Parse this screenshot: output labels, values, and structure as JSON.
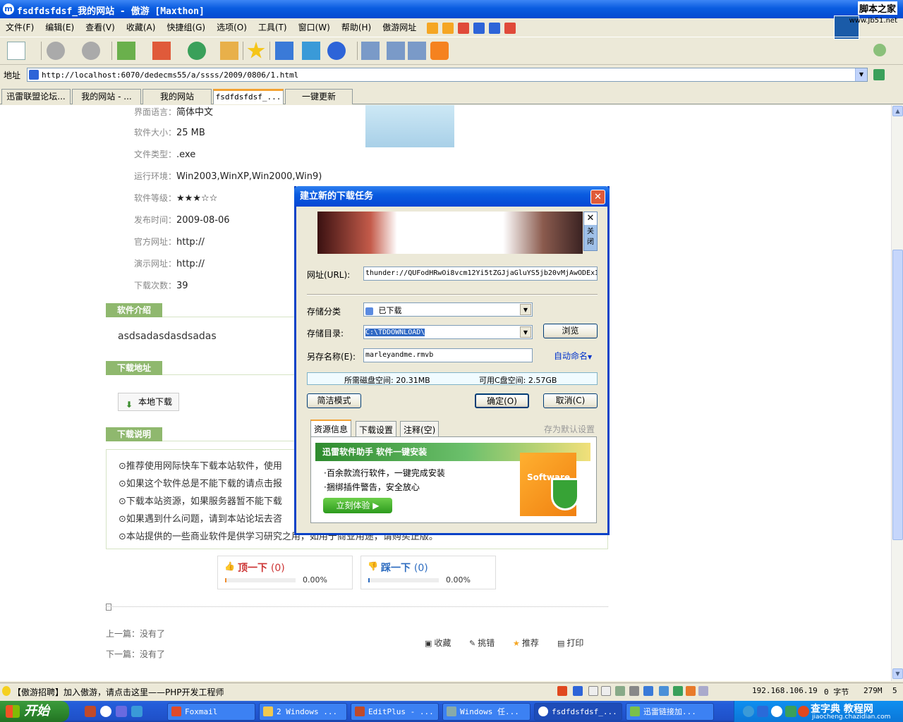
{
  "window": {
    "title": "fsdfdsfdsf_我的网站 - 傲游 [Maxthon]",
    "app_icon": "m",
    "brand_line1": "脚本之家",
    "brand_line2": "www.Jb51.net"
  },
  "menu": {
    "items": [
      "文件(F)",
      "编辑(E)",
      "查看(V)",
      "收藏(A)",
      "快捷组(G)",
      "选项(O)",
      "工具(T)",
      "窗口(W)",
      "帮助(H)",
      "傲游网址"
    ]
  },
  "address": {
    "label": "地址",
    "url": "http://localhost:6070/dedecms55/a/ssss/2009/0806/1.html"
  },
  "tabs": [
    "迅雷联盟论坛...",
    "我的网站 - ...",
    "我的网站",
    "fsdfdsfdsf_...",
    "一键更新"
  ],
  "page": {
    "info": [
      {
        "k": "界面语言：",
        "v": "简体中文"
      },
      {
        "k": "软件大小：",
        "v": "25 MB"
      },
      {
        "k": "文件类型：",
        "v": ".exe"
      },
      {
        "k": "运行环境：",
        "v": "Win2003,WinXP,Win2000,Win9)"
      },
      {
        "k": "软件等级：",
        "v": "★★★☆☆"
      },
      {
        "k": "发布时间：",
        "v": "2009-08-06"
      },
      {
        "k": "官方网址：",
        "v": "http://"
      },
      {
        "k": "演示网址：",
        "v": "http://"
      },
      {
        "k": "下载次数：",
        "v": "39"
      }
    ],
    "sec_intro": "软件介绍",
    "intro_text": "asdsadasdasdsadas",
    "sec_download": "下载地址",
    "local_download": "本地下载",
    "sec_notes": "下载说明",
    "notes": [
      "⊙推荐使用网际快车下载本站软件，使用",
      "⊙如果这个软件总是不能下载的请点击报",
      "⊙下载本站资源，如果服务器暂不能下载",
      "⊙如果遇到什么问题，请到本站论坛去咨",
      "⊙本站提供的一些商业软件是供学习研究之用，如用于商业用途，请购买正版。"
    ],
    "vote_up": {
      "label": "顶一下",
      "count": "(0)",
      "pct": "0.00%"
    },
    "vote_down": {
      "label": "踩一下",
      "count": "(0)",
      "pct": "0.00%"
    },
    "prev": "上一篇：没有了",
    "next": "下一篇：没有了",
    "actions": [
      "收藏",
      "挑错",
      "推荐",
      "打印"
    ]
  },
  "dialog": {
    "title": "建立新的下载任务",
    "banner_close_side": "关闭",
    "url_label": "网址(URL):",
    "url_value": "thunder://QUFodHRwOi8vcm12Yi5tZGJjaGluYS5jb20vMjAwODExI",
    "category_label": "存储分类",
    "category_value": "已下载",
    "dir_label": "存储目录:",
    "dir_value": "C:\\TDDOWNLOAD\\",
    "browse": "浏览",
    "saveas_label": "另存名称(E):",
    "saveas_value": "marleyandme.rmvb",
    "auto_rename": "自动命名",
    "disk_needed": "所需磁盘空间: 20.31MB",
    "disk_free": "可用C盘空间: 2.57GB",
    "simple_mode": "简洁模式",
    "ok": "确定(O)",
    "cancel": "取消(C)",
    "tabs": [
      "资源信息",
      "下载设置",
      "注释(空)"
    ],
    "save_default": "存为默认设置",
    "ad_title": "迅雷软件助手  软件一键安装",
    "ad_line1": "·百余款流行软件，一键完成安装",
    "ad_line2": "·捆绑插件警告，安全放心",
    "ad_try": "立刻体验 ▶",
    "ad_box": "Software"
  },
  "status": {
    "message": "【傲游招聘】加入傲游，请点击这里——PHP开发工程师",
    "ip": "192.168.106.19",
    "bytes": "0 字节",
    "mem": "279M",
    "num": "5"
  },
  "taskbar": {
    "start": "开始",
    "tasks": [
      "Foxmail",
      "2 Windows ...",
      "EditPlus - ...",
      "Windows 任...",
      "fsdfdsfdsf_...",
      "迅雷链接加..."
    ],
    "watermark1": "查字典 教程网",
    "watermark2": "jiaocheng.chazidian.com"
  },
  "colors": {
    "titlebar": "#0a5ce0",
    "section_header": "#8fb86e",
    "active_tab": "#f3a233"
  }
}
